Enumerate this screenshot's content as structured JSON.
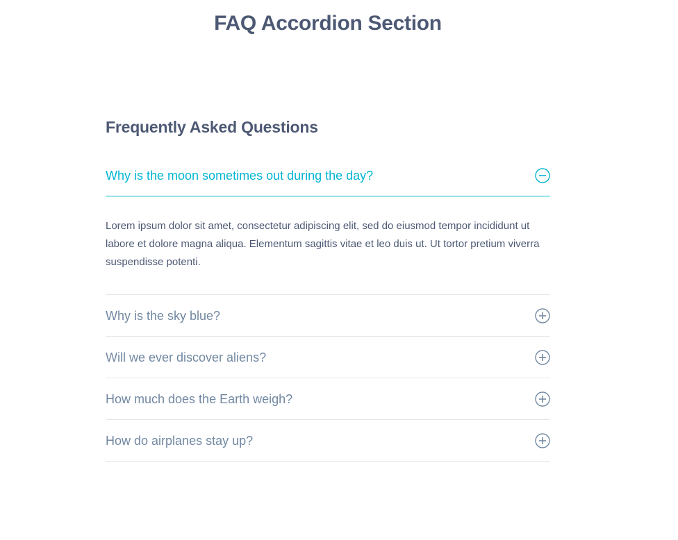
{
  "page": {
    "title": "FAQ Accordion Section"
  },
  "faq": {
    "heading": "Frequently Asked Questions",
    "items": [
      {
        "question": "Why is the moon sometimes out during the day?",
        "expanded": true,
        "answer": "Lorem ipsum dolor sit amet, consectetur adipiscing elit, sed do eiusmod tempor incididunt ut labore et dolore magna aliqua. Elementum sagittis vitae et leo duis ut. Ut tortor pretium viverra suspendisse potenti.",
        "icon": "minus-circle-icon"
      },
      {
        "question": "Why is the sky blue?",
        "expanded": false,
        "icon": "plus-circle-icon"
      },
      {
        "question": "Will we ever discover aliens?",
        "expanded": false,
        "icon": "plus-circle-icon"
      },
      {
        "question": "How much does the Earth weigh?",
        "expanded": false,
        "icon": "plus-circle-icon"
      },
      {
        "question": "How do airplanes stay up?",
        "expanded": false,
        "icon": "plus-circle-icon"
      }
    ]
  },
  "colors": {
    "text": "#4d5974",
    "question": "#7288a2",
    "accent": "#03b5d2",
    "divider": "#e5e5e5"
  }
}
